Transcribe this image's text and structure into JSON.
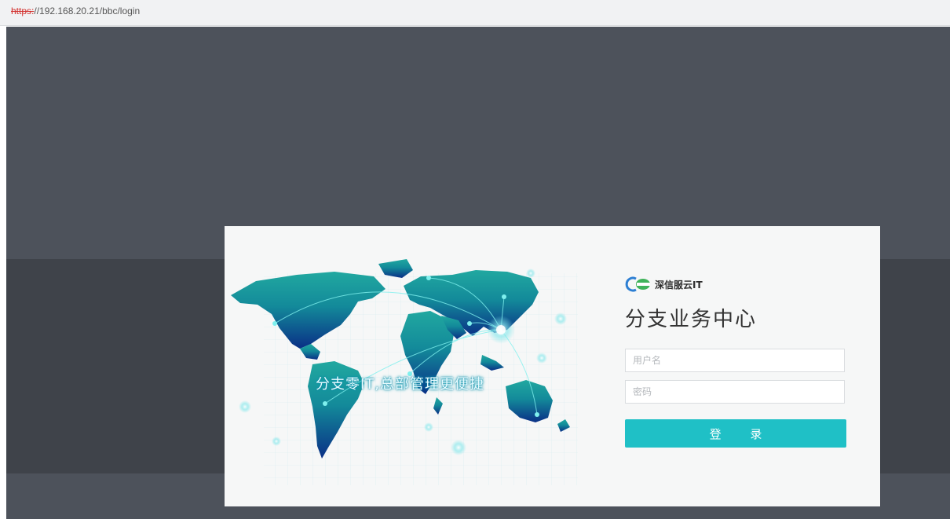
{
  "browser": {
    "url_scheme": "https:",
    "url_rest": "//192.168.20.21/bbc/login"
  },
  "login_card": {
    "slogan": "分支零IT,总部管理更便捷",
    "brand_name": "深信服云IT",
    "title": "分支业务中心",
    "username_placeholder": "用户名",
    "password_placeholder": "密码",
    "login_label": "登 录"
  },
  "icons": {
    "brand_logo": "sangfor-cloud-logo-icon",
    "map": "world-map-illustration"
  },
  "colors": {
    "page_background": "#4d525b",
    "band_background": "#3f434a",
    "card_background": "#f6f7f7",
    "accent": "#1fc0c6",
    "map_teal": "#19a6a4",
    "map_blue": "#0b3f8f",
    "url_scheme_red": "#d3322f"
  }
}
